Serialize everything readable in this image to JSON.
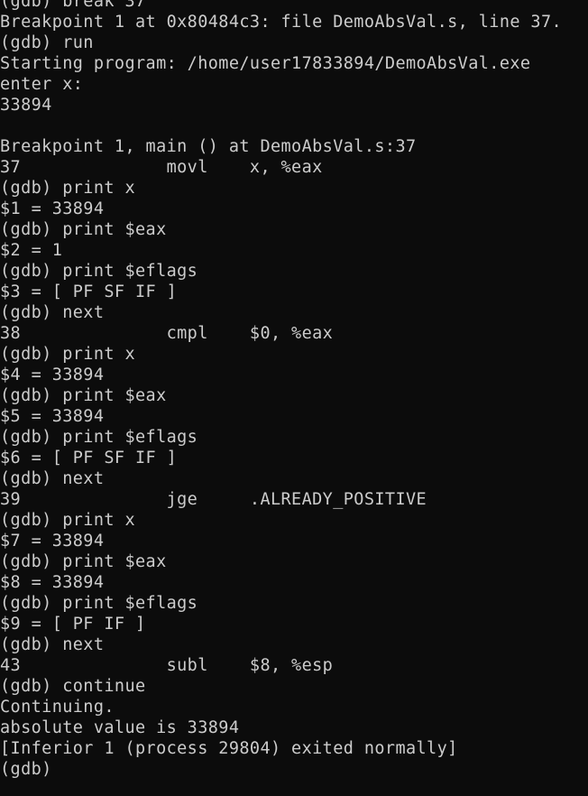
{
  "terminal": {
    "lines": [
      "(gdb) break 37",
      "Breakpoint 1 at 0x80484c3: file DemoAbsVal.s, line 37.",
      "(gdb) run",
      "Starting program: /home/user17833894/DemoAbsVal.exe",
      "enter x:",
      "33894",
      "",
      "Breakpoint 1, main () at DemoAbsVal.s:37",
      "37              movl    x, %eax",
      "(gdb) print x",
      "$1 = 33894",
      "(gdb) print $eax",
      "$2 = 1",
      "(gdb) print $eflags",
      "$3 = [ PF SF IF ]",
      "(gdb) next",
      "38              cmpl    $0, %eax",
      "(gdb) print x",
      "$4 = 33894",
      "(gdb) print $eax",
      "$5 = 33894",
      "(gdb) print $eflags",
      "$6 = [ PF SF IF ]",
      "(gdb) next",
      "39              jge     .ALREADY_POSITIVE",
      "(gdb) print x",
      "$7 = 33894",
      "(gdb) print $eax",
      "$8 = 33894",
      "(gdb) print $eflags",
      "$9 = [ PF IF ]",
      "(gdb) next",
      "43              subl    $8, %esp",
      "(gdb) continue",
      "Continuing.",
      "absolute value is 33894",
      "[Inferior 1 (process 29804) exited normally]",
      "(gdb)"
    ]
  },
  "colors": {
    "background": "#0c0c0c",
    "foreground": "#cccccc"
  }
}
